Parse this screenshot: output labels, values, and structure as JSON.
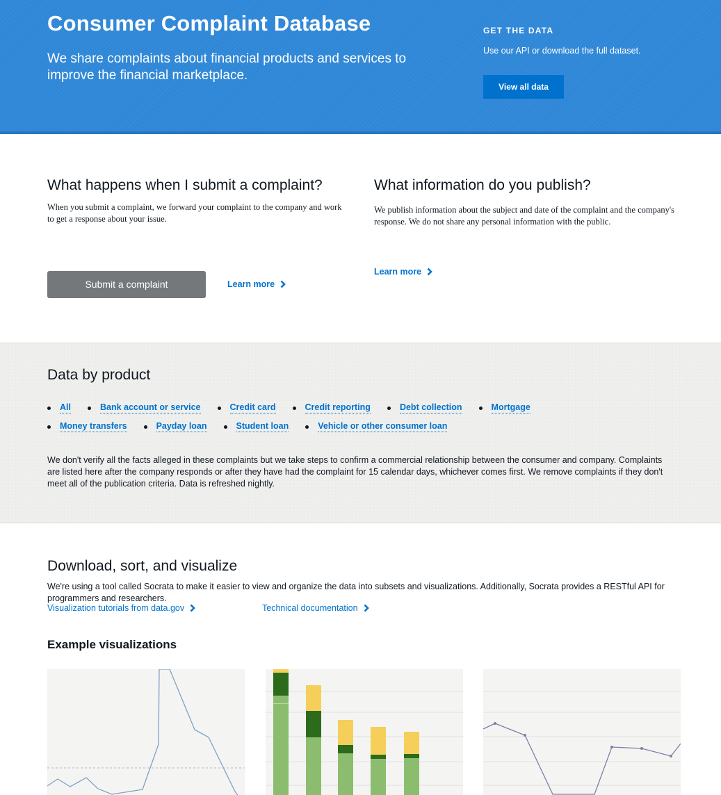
{
  "hero": {
    "title": "Consumer Complaint Database",
    "subtitle": "We share complaints about financial products and services to improve the financial marketplace.",
    "get_data_heading": "GET THE DATA",
    "get_data_text": "Use our API or download the full dataset.",
    "view_all_label": "View all data"
  },
  "submit_section": {
    "heading": "What happens when I submit a complaint?",
    "body": "When you submit a complaint, we forward your complaint to the company and work to get a response about your issue.",
    "button_label": "Submit a complaint",
    "learn_more": "Learn more"
  },
  "publish_section": {
    "heading": "What information do you publish?",
    "body": "We publish information about the subject and date of the complaint and the company's response. We do not share any personal information with the public.",
    "learn_more": "Learn more"
  },
  "product_section": {
    "heading": "Data by product",
    "rows": [
      [
        "All",
        "Bank account or service",
        "Credit card",
        "Credit reporting",
        "Debt collection",
        "Mortgage"
      ],
      [
        "Money transfers",
        "Payday loan",
        "Student loan",
        "Vehicle or other consumer loan"
      ]
    ],
    "disclaimer": "We don't verify all the facts alleged in these complaints but we take steps to confirm a commercial relationship between the consumer and company. Complaints are listed here after the company responds or after they have had the complaint for 15 calendar days, whichever comes first. We remove complaints if they don't meet all of the publication criteria. Data is refreshed nightly."
  },
  "download_section": {
    "heading": "Download, sort, and visualize",
    "body": "We're using a tool called Socrata to make it easier to view and organize the data into subsets and visualizations. Additionally, Socrata provides a RESTful API for programmers and researchers.",
    "link_tutorials": "Visualization tutorials from data.gov",
    "link_docs": "Technical documentation"
  },
  "examples": {
    "heading": "Example visualizations"
  },
  "colors": {
    "hero_blue": "#2f87d7",
    "link_blue": "#0072ce",
    "button_gray": "#75787b",
    "dark_green": "#2b6b1b",
    "light_green": "#8cbd6f",
    "gold": "#f6cf5a",
    "line_blue": "#7ea2c8",
    "line_purple": "#7d7fa6"
  }
}
